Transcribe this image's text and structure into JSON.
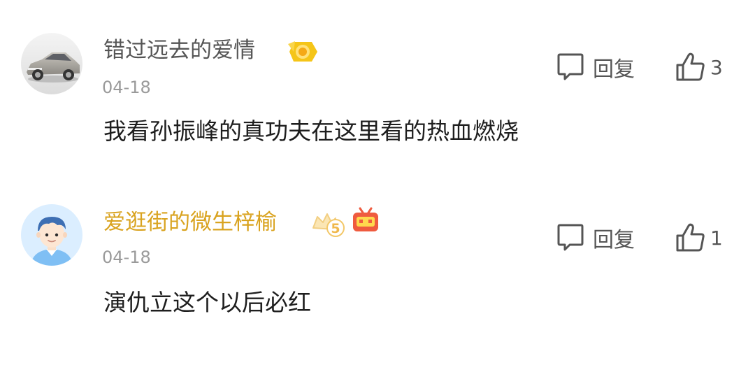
{
  "comments": [
    {
      "username": "错过远去的爱情",
      "date": "04-18",
      "text": "我看孙振峰的真功夫在这里看的热血燃烧",
      "reply_label": "回复",
      "like_count": "3",
      "avatar_icon": "car-avatar-icon",
      "badges": [
        "yellow-medal-icon"
      ],
      "username_color": "#555555"
    },
    {
      "username": "爱逛街的微生梓榆",
      "date": "04-18",
      "text": "演仇立这个以后必红",
      "reply_label": "回复",
      "like_count": "1",
      "avatar_icon": "boy-avatar-icon",
      "badges": [
        "level-5-badge-icon",
        "tv-badge-icon"
      ],
      "username_color": "#d9a31f"
    }
  ],
  "colors": {
    "primary_text": "#1e1e1e",
    "secondary_text": "#555555",
    "muted_text": "#9a9a9a",
    "vip_name": "#d9a31f",
    "badge_yellow": "#f5c518",
    "badge_red": "#ef5b3f"
  }
}
